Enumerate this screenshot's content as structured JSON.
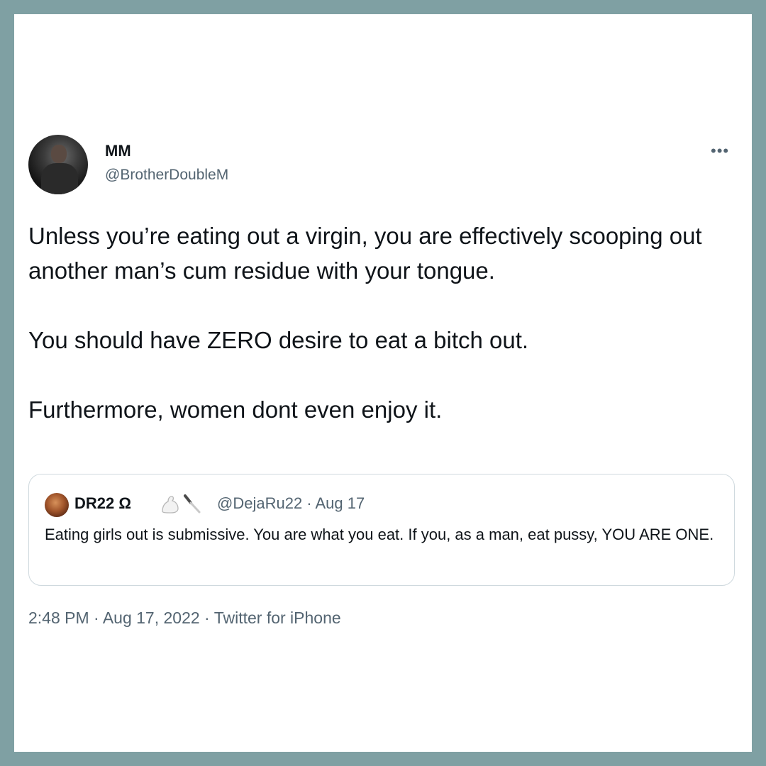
{
  "tweet": {
    "author_name": "MM",
    "author_handle": "@BrotherDoubleM",
    "more_icon": "more-horizontal-icon",
    "paragraphs": [
      "Unless you’re eating out a virgin, you are effectively scooping out another man’s cum residue with your tongue.",
      "You should have ZERO desire to eat a bitch out.",
      "Furthermore, women dont even enjoy it."
    ],
    "timestamp": "2:48 PM · Aug 17, 2022 · Twitter for iPhone"
  },
  "quoted_tweet": {
    "author_name": "DR22 Ω",
    "emojis": [
      "flexed-biceps-icon",
      "knife-icon"
    ],
    "handle_date": "@DejaRu22 · Aug 17",
    "text": "Eating girls out is submissive. You are what you eat. If you, as a man, eat pussy, YOU ARE ONE."
  },
  "colors": {
    "outer_border": "#7fa0a3",
    "card_background": "#ffffff",
    "primary_text": "#0f1419",
    "secondary_text": "#536471",
    "quote_border": "#cfd9de"
  }
}
